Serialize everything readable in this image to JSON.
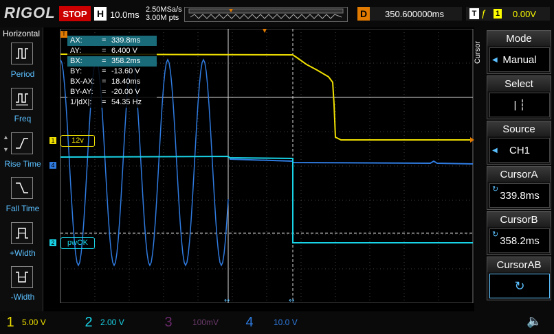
{
  "brand": "RIGOL",
  "run_state": "STOP",
  "timebase": {
    "label": "H",
    "value": "10.0ms"
  },
  "sampling": {
    "rate": "2.50MSa/s",
    "points": "3.00M pts"
  },
  "delay": {
    "label": "D",
    "value": "350.600000ms"
  },
  "trigger": {
    "label": "T",
    "channel": "1",
    "level": "0.00V"
  },
  "left_menu": {
    "title": "Horizontal",
    "items": [
      {
        "label": "Period"
      },
      {
        "label": "Freq"
      },
      {
        "label": "Rise Time"
      },
      {
        "label": "Fall Time"
      },
      {
        "label": "+Width"
      },
      {
        "label": "-Width"
      }
    ]
  },
  "right_menu": {
    "side_label": "Cursor",
    "items": [
      {
        "header": "Mode",
        "value": "Manual"
      },
      {
        "header": "Select",
        "value": "| ┆"
      },
      {
        "header": "Source",
        "value": "CH1"
      },
      {
        "header": "CursorA",
        "value": "339.8ms"
      },
      {
        "header": "CursorB",
        "value": "358.2ms"
      },
      {
        "header": "CursorAB",
        "value": ""
      }
    ]
  },
  "readout": {
    "rows": [
      {
        "k": "AX:",
        "v": "339.8ms"
      },
      {
        "k": "AY:",
        "v": "6.400 V"
      },
      {
        "k": "BX:",
        "v": "358.2ms"
      },
      {
        "k": "BY:",
        "v": "-13.60 V"
      },
      {
        "k": "BX-AX:",
        "v": "18.40ms"
      },
      {
        "k": "BY-AY:",
        "v": "-20.00 V"
      },
      {
        "k": "1/|dX|:",
        "v": "54.35 Hz"
      }
    ]
  },
  "channel_labels": {
    "ch1": "12v",
    "ch2": "pwOK"
  },
  "channels": [
    {
      "num": "1",
      "scale": "5.00 V",
      "color": "#f0e000"
    },
    {
      "num": "2",
      "scale": "2.00 V",
      "color": "#19d3e6"
    },
    {
      "num": "3",
      "scale": "100mV",
      "color": "#c94fc9"
    },
    {
      "num": "4",
      "scale": "10.0 V",
      "color": "#2f7be0"
    }
  ],
  "colors": {
    "ch1": "#f0e000",
    "ch2": "#19d3e6",
    "ch4": "#2f7be0",
    "trigger": "#e07a00",
    "grid": "#555555"
  }
}
